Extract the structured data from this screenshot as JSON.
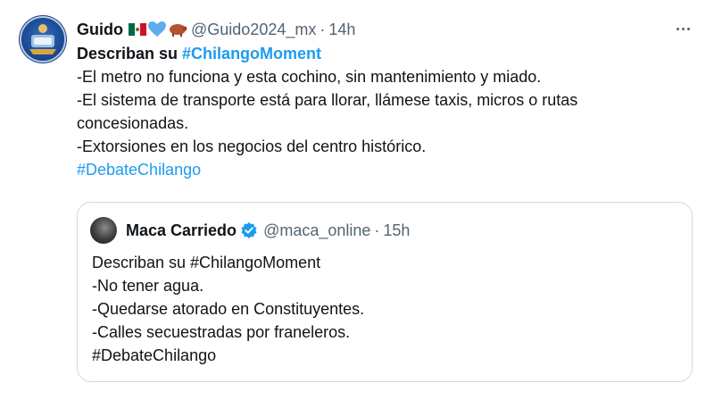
{
  "tweet": {
    "display_name": "Guido",
    "emojis": [
      "mexico-flag-emoji",
      "blue-heart-emoji",
      "pig-emoji"
    ],
    "handle": "@Guido2024_mx",
    "separator": "·",
    "time": "14h",
    "lines": {
      "intro_prefix": "Describan su ",
      "intro_hashtag": "#ChilangoMoment",
      "line1": "-El metro no funciona y esta cochino, sin mantenimiento y miado.",
      "line2": "-El sistema de transporte está para llorar, llámese taxis, micros o rutas concesionadas.",
      "line3": "-Extorsiones en los negocios del centro histórico.",
      "hashtag": "#DebateChilango"
    }
  },
  "quote": {
    "display_name": "Maca Carriedo",
    "handle": "@maca_online",
    "separator": "·",
    "time": "15h",
    "lines": [
      "Describan su #ChilangoMoment",
      "-No tener agua.",
      "-Quedarse atorado en Constituyentes.",
      "-Calles secuestradas por franeleros.",
      "#DebateChilango"
    ]
  },
  "colors": {
    "text": "#0f1419",
    "secondary": "#536471",
    "link": "#1d9bf0",
    "border": "#cfd9de"
  }
}
